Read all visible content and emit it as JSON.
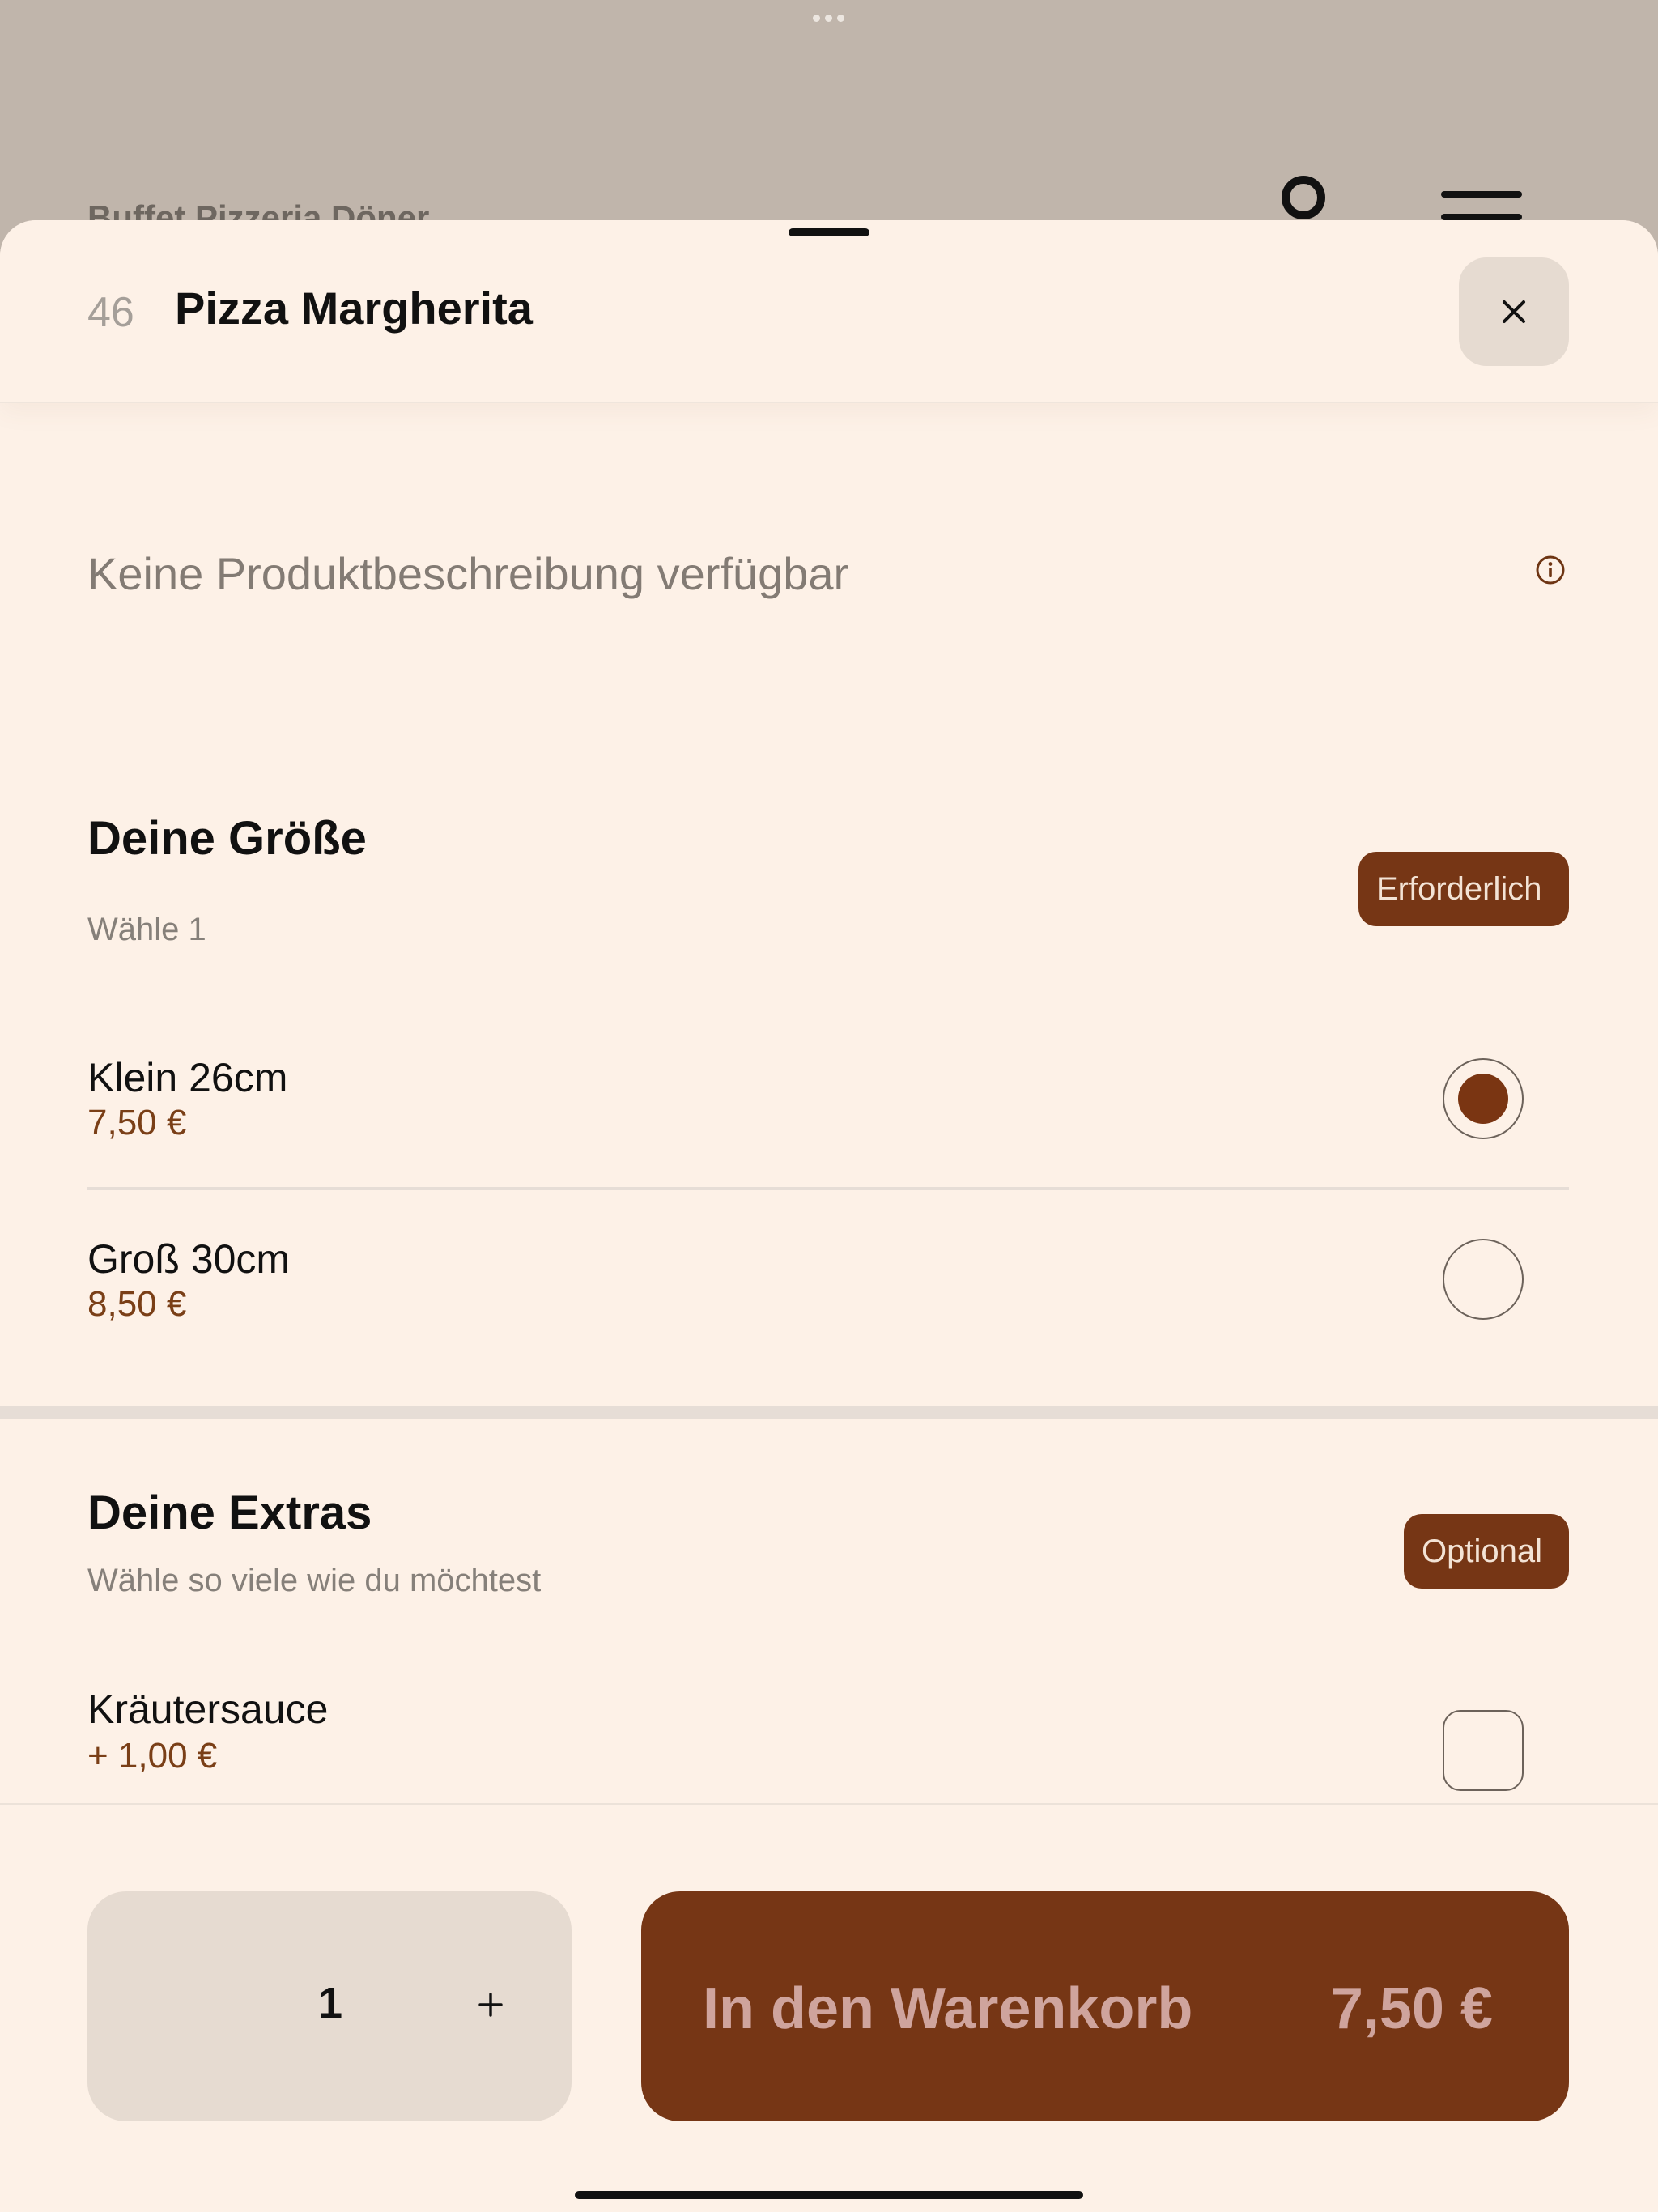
{
  "background": {
    "restaurant_title": "Buffet Pizzeria Döner",
    "user_icon": "user-icon",
    "menu_icon": "menu-icon"
  },
  "header": {
    "item_number": "46",
    "item_title": "Pizza Margherita",
    "close_icon": "close-icon"
  },
  "description": {
    "text": "Keine Produktbeschreibung verfügbar",
    "info_icon": "info-icon"
  },
  "size_section": {
    "title": "Deine Größe",
    "subtitle": "Wähle 1",
    "badge": "Erforderlich",
    "options": [
      {
        "name": "Klein 26cm",
        "price": "7,50 €",
        "selected": true
      },
      {
        "name": "Groß 30cm",
        "price": "8,50 €",
        "selected": false
      }
    ]
  },
  "extras_section": {
    "title": "Deine Extras",
    "subtitle": "Wähle so viele wie du möchtest",
    "badge": "Optional",
    "options": [
      {
        "name": "Kräutersauce",
        "price": "+ 1,00 €",
        "checked": false
      }
    ]
  },
  "footer": {
    "quantity": "1",
    "plus_icon": "plus-icon",
    "cart_label": "In den Warenkorb",
    "cart_price": "7,50 €"
  },
  "colors": {
    "accent": "#763615",
    "sheet_background": "#fdf1e7",
    "backdrop": "#c0b5ab",
    "price_text": "#7a3f17"
  }
}
